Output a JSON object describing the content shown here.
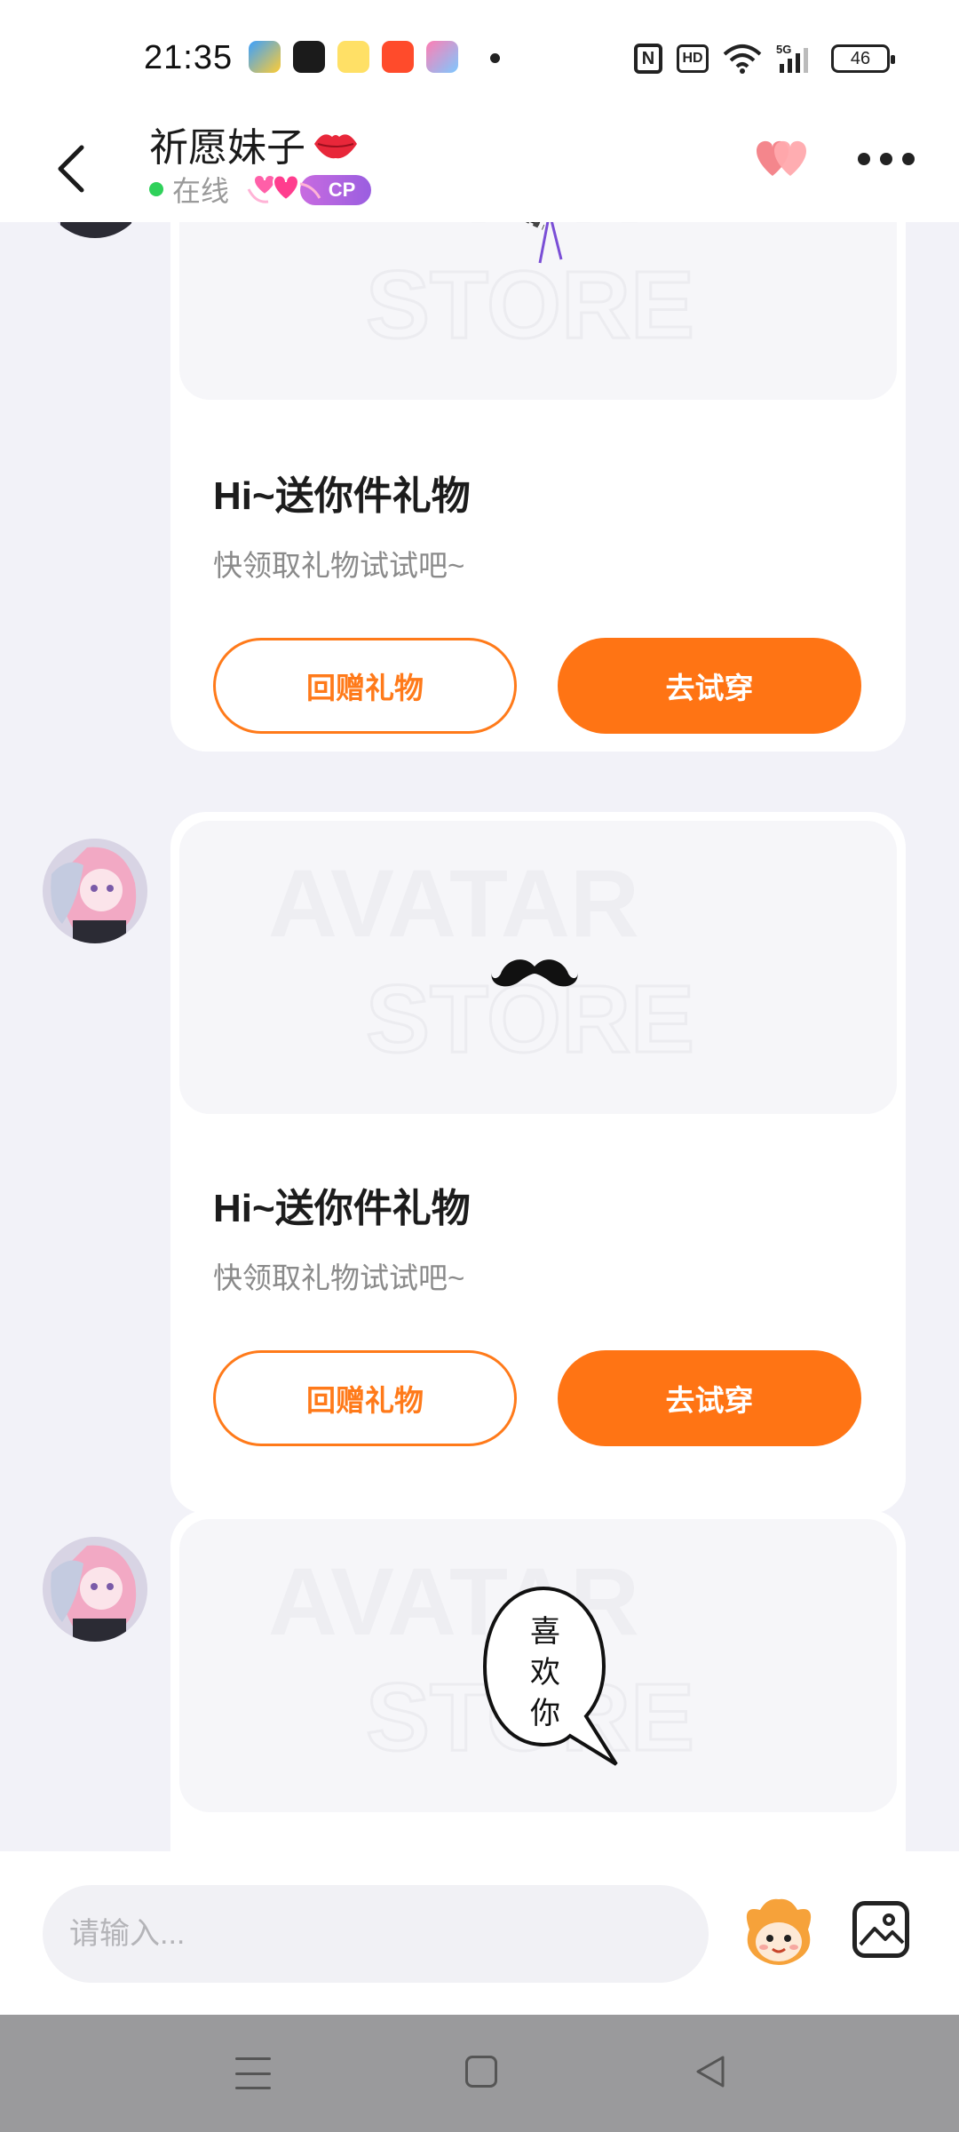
{
  "status_bar": {
    "time": "21:35",
    "battery": "46",
    "hd_label": "HD",
    "nfc_label": "N",
    "network": "5G"
  },
  "header": {
    "contact_name": "祈愿妹子",
    "online_status": "在线",
    "cp_badge": "CP"
  },
  "messages": [
    {
      "title": "Hi~送你件礼物",
      "subtitle": "快领取礼物试试吧~",
      "return_gift_label": "回赠礼物",
      "try_on_label": "去试穿",
      "item": "lace-headband"
    },
    {
      "title": "Hi~送你件礼物",
      "subtitle": "快领取礼物试试吧~",
      "return_gift_label": "回赠礼物",
      "try_on_label": "去试穿",
      "item": "mustache"
    },
    {
      "item": "speech-bubble-sticker",
      "sticker_text": [
        "喜",
        "欢",
        "你"
      ]
    }
  ],
  "watermark": {
    "line1": "AVATAR",
    "line2": "STORE"
  },
  "input_bar": {
    "placeholder": "请输入..."
  },
  "colors": {
    "accent": "#ff7414",
    "online": "#2fd15a",
    "cp_gradient_start": "#c86be0",
    "cp_gradient_end": "#9a5ee0"
  }
}
